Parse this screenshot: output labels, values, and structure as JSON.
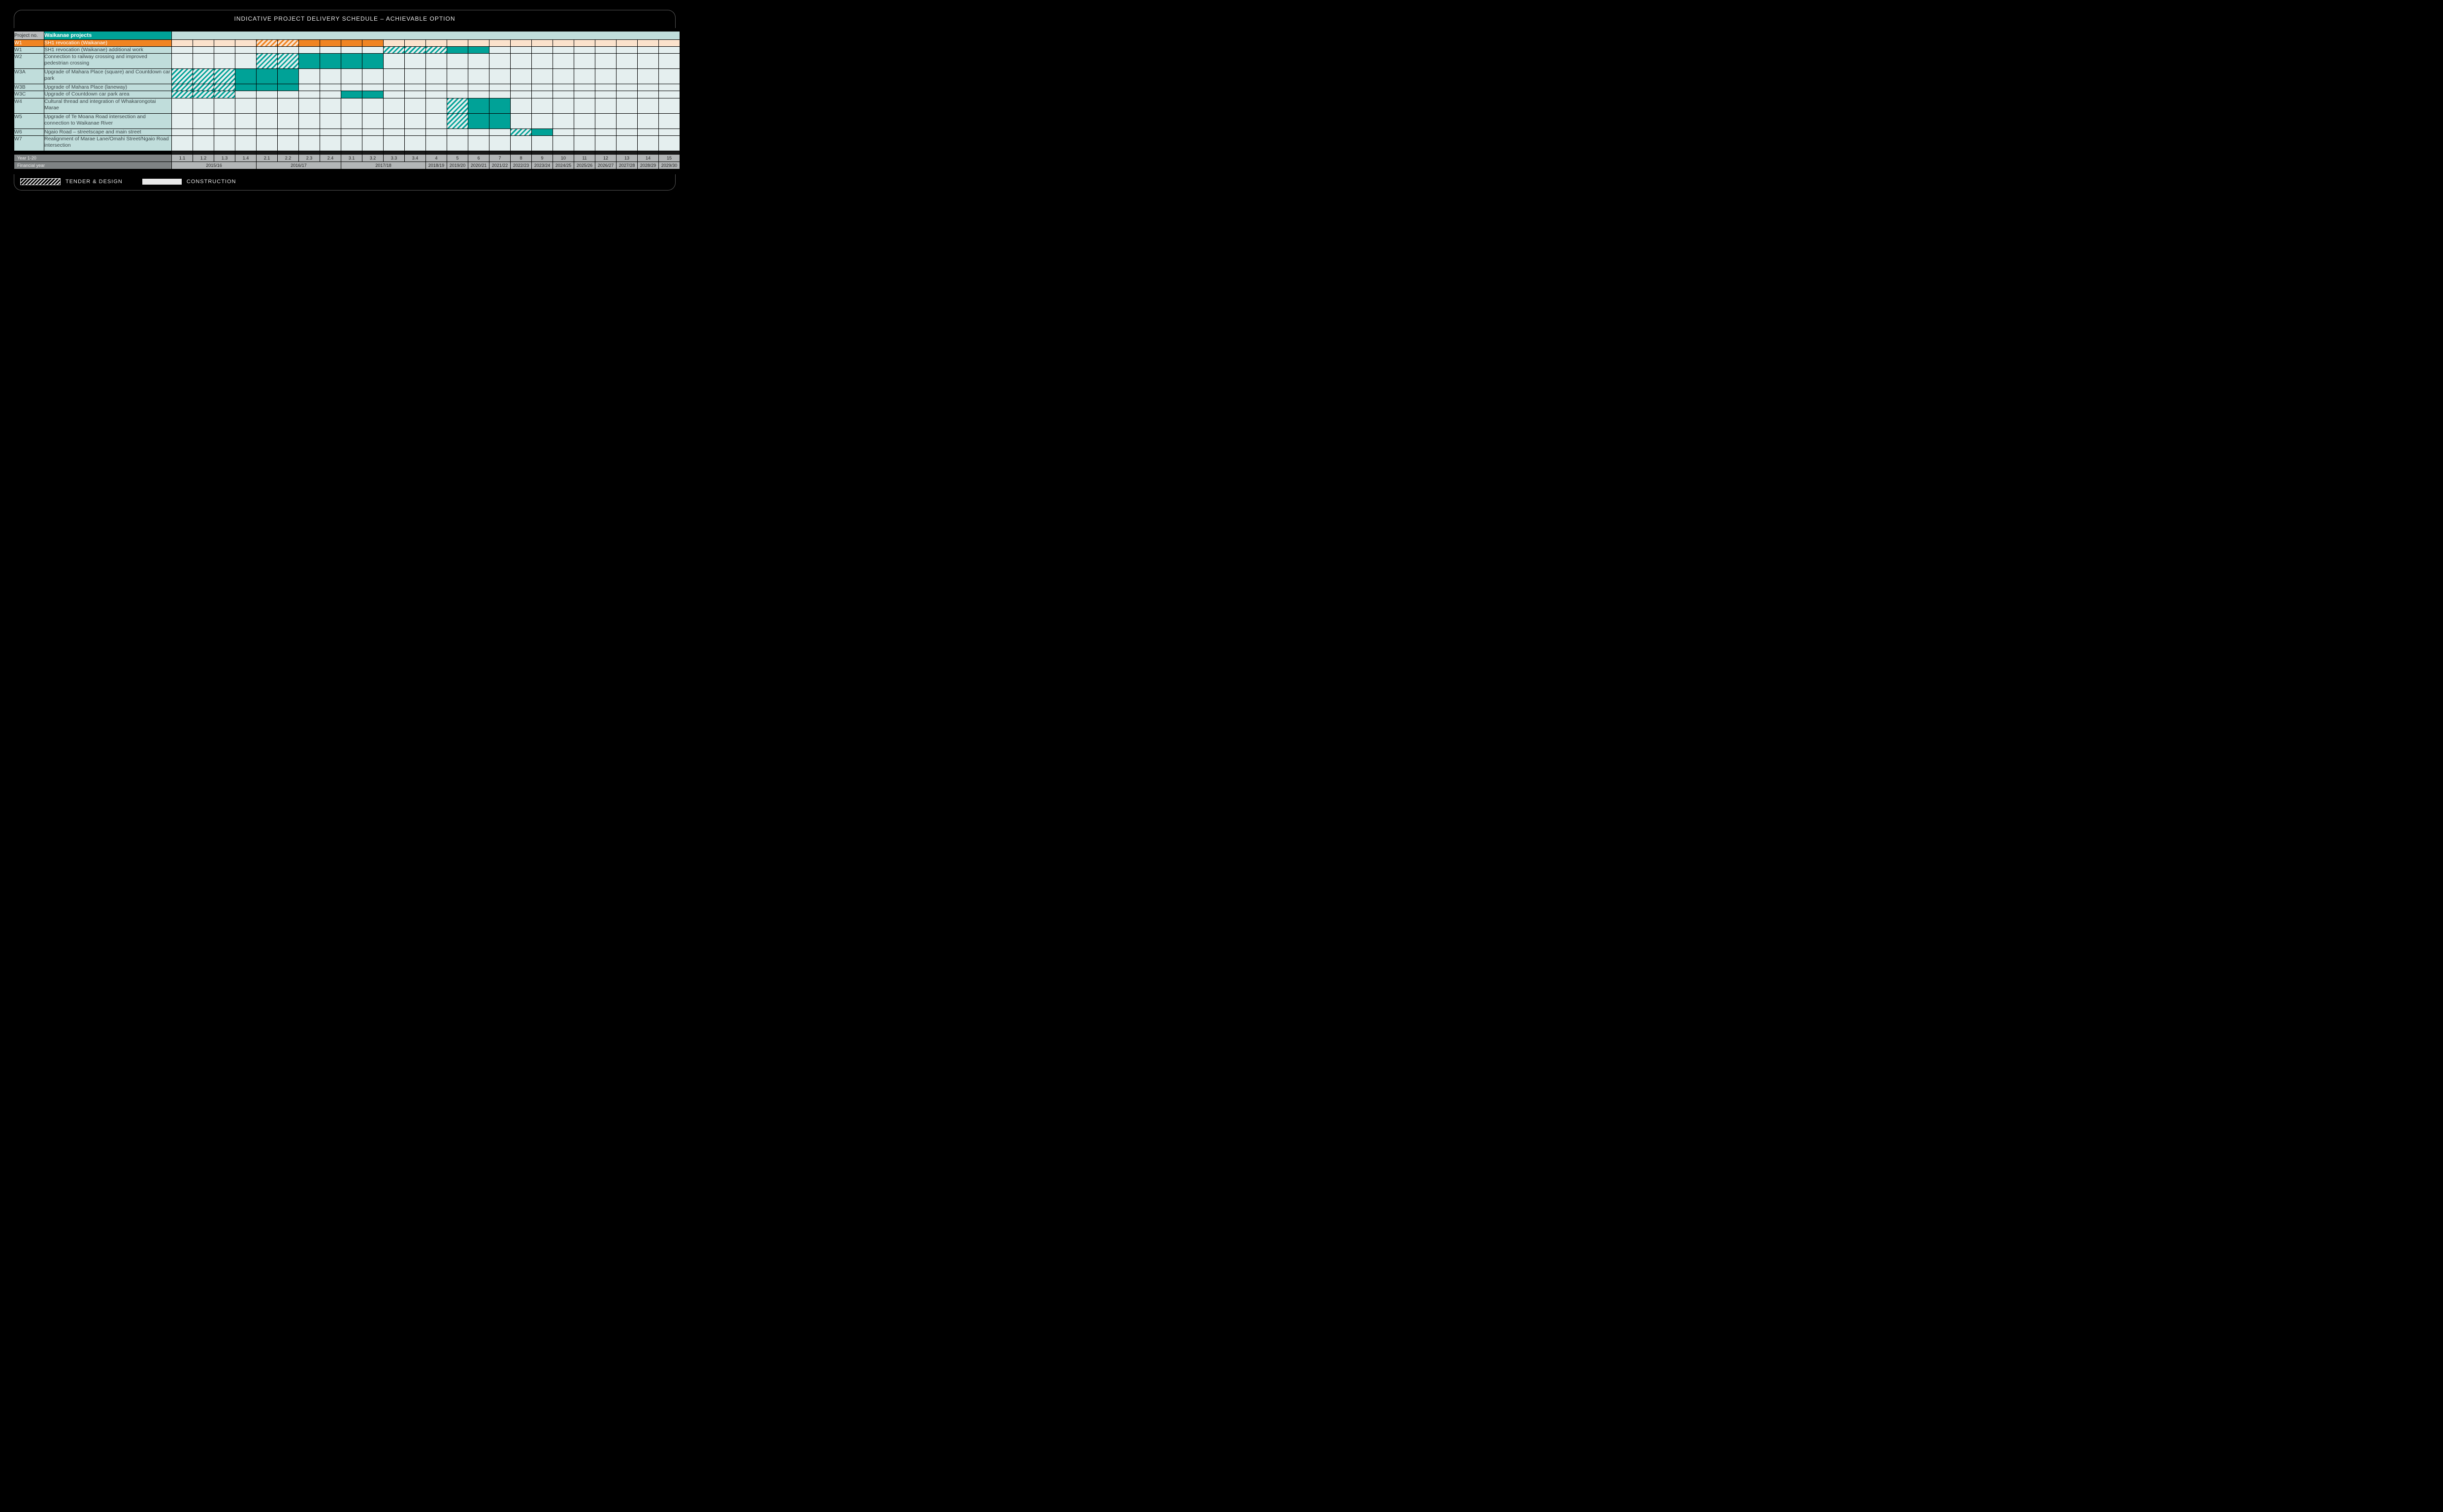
{
  "title": "INDICATIVE PROJECT DELIVERY SCHEDULE – ACHIEVABLE OPTION",
  "header": {
    "project_no_label": "Project no.",
    "group_label": "Waikanae projects"
  },
  "legend": {
    "tender": "TENDER & DESIGN",
    "construction": "CONSTRUCTION"
  },
  "axis": {
    "year_row_label": "Year 1-20",
    "fin_row_label": "Financial year"
  },
  "chart_data": {
    "type": "bar",
    "title": "Indicative Project Delivery Schedule – Achievable Option (Waikanae projects)",
    "xlabel": "Year / Financial year",
    "ylabel": "Project",
    "columns_count": 24,
    "year_labels": [
      "1.1",
      "1.2",
      "1.3",
      "1.4",
      "2.1",
      "2.2",
      "2.3",
      "2.4",
      "3.1",
      "3.2",
      "3.3",
      "3.4",
      "4",
      "5",
      "6",
      "7",
      "8",
      "9",
      "10",
      "11",
      "12",
      "13",
      "14",
      "15"
    ],
    "financial_years": [
      {
        "label": "2015/16",
        "span": 4
      },
      {
        "label": "2016/17",
        "span": 4
      },
      {
        "label": "2017/18",
        "span": 4
      },
      {
        "label": "2018/19",
        "span": 1
      },
      {
        "label": "2019/20",
        "span": 1
      },
      {
        "label": "2020/21",
        "span": 1
      },
      {
        "label": "2021/22",
        "span": 1
      },
      {
        "label": "2022/23",
        "span": 1
      },
      {
        "label": "2023/24",
        "span": 1
      },
      {
        "label": "2024/25",
        "span": 1
      },
      {
        "label": "2025/26",
        "span": 1
      },
      {
        "label": "2026/27",
        "span": 1
      },
      {
        "label": "2027/28",
        "span": 1
      },
      {
        "label": "2028/29",
        "span": 1
      },
      {
        "label": "2029/30",
        "span": 1
      }
    ],
    "projects": [
      {
        "no": "W1",
        "name": "SH1 revocation (Waikanae)",
        "color": "orange",
        "tall": false,
        "bars": [
          {
            "type": "tender",
            "start": 5,
            "end": 6
          },
          {
            "type": "construction",
            "start": 7,
            "end": 10
          }
        ]
      },
      {
        "no": "W1",
        "name": "SH1 revocation (Waikanae) additional work",
        "color": "teal",
        "tall": false,
        "bars": [
          {
            "type": "tender",
            "start": 11,
            "end": 13
          },
          {
            "type": "construction",
            "start": 14,
            "end": 15
          }
        ]
      },
      {
        "no": "W2",
        "name": "Connection to railway crossing and improved pedestrian crossing",
        "color": "teal",
        "tall": true,
        "bars": [
          {
            "type": "tender",
            "start": 5,
            "end": 6
          },
          {
            "type": "construction",
            "start": 7,
            "end": 10
          }
        ]
      },
      {
        "no": "W3A",
        "name": "Upgrade of Mahara Place (square) and Countdown car park",
        "color": "teal",
        "tall": true,
        "bars": [
          {
            "type": "tender",
            "start": 1,
            "end": 3
          },
          {
            "type": "construction",
            "start": 4,
            "end": 6
          }
        ]
      },
      {
        "no": "W3B",
        "name": "Upgrade of Mahara Place (laneway)",
        "color": "teal",
        "tall": false,
        "bars": [
          {
            "type": "tender",
            "start": 1,
            "end": 3
          },
          {
            "type": "construction",
            "start": 4,
            "end": 6
          }
        ]
      },
      {
        "no": "W3C",
        "name": "Upgrade of Countdown car park area",
        "color": "teal",
        "tall": false,
        "bars": [
          {
            "type": "tender",
            "start": 1,
            "end": 3
          },
          {
            "type": "construction",
            "start": 9,
            "end": 10
          }
        ]
      },
      {
        "no": "W4",
        "name": "Cultural thread and integration of Whakarongotai Marae",
        "color": "teal",
        "tall": true,
        "bars": [
          {
            "type": "tender",
            "start": 14,
            "end": 14
          },
          {
            "type": "construction",
            "start": 15,
            "end": 16
          }
        ]
      },
      {
        "no": "W5",
        "name": "Upgrade of Te Moana Road intersection and connection to Waikanae River",
        "color": "teal",
        "tall": true,
        "bars": [
          {
            "type": "tender",
            "start": 14,
            "end": 14
          },
          {
            "type": "construction",
            "start": 15,
            "end": 16
          }
        ]
      },
      {
        "no": "W6",
        "name": "Ngaio Road – streetscape and main street",
        "color": "teal",
        "tall": false,
        "bars": [
          {
            "type": "tender",
            "start": 17,
            "end": 17
          },
          {
            "type": "construction",
            "start": 18,
            "end": 18
          }
        ]
      },
      {
        "no": "W7",
        "name": "Realignment of Marae Lane/Omahi Street/Ngaio Road intersection",
        "color": "teal",
        "tall": true,
        "bars": []
      }
    ]
  }
}
